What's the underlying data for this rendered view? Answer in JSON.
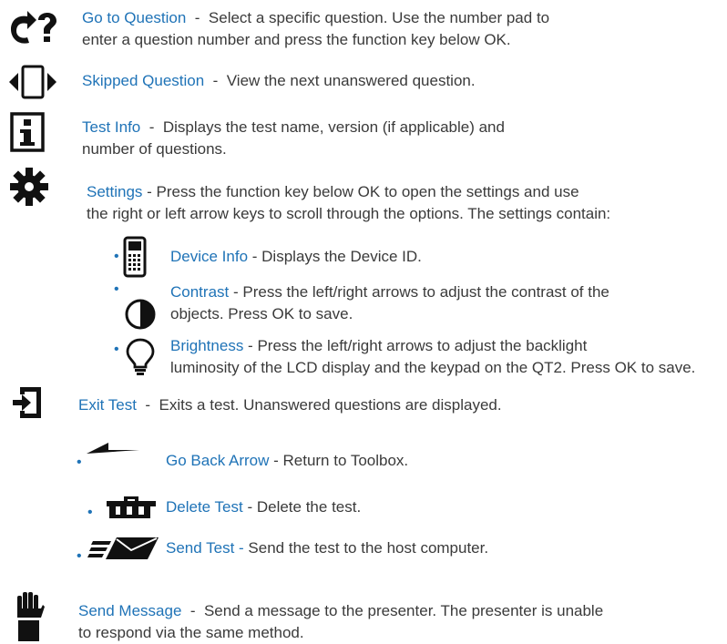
{
  "accent_color": "#1f73b7",
  "items": {
    "goto": {
      "icon": "go-to-question-icon",
      "term": "Go to Question",
      "sep": "  -  ",
      "line1": "Select a specific question. Use the number pad to",
      "line2": "enter a question number and press the function key below OK."
    },
    "skipped": {
      "icon": "skipped-question-icon",
      "term": "Skipped Question",
      "sep": "  -  ",
      "line1": "View the next unanswered question."
    },
    "testinfo": {
      "icon": "info-icon",
      "term": "Test Info",
      "sep": "  -  ",
      "line1": "Displays the test name, version (if applicable) and",
      "line2": "number of questions."
    },
    "settings": {
      "icon": "gear-icon",
      "term": "Settings",
      "sep": " - ",
      "line1": "Press the function key below OK to open the settings and use",
      "line2": "the right or left arrow keys to scroll through the options. The settings contain:"
    },
    "deviceinfo": {
      "icon": "device-icon",
      "term": "Device Info",
      "sep": " - ",
      "line1": "Displays the Device ID."
    },
    "contrast": {
      "icon": "contrast-icon",
      "term": "Contrast",
      "sep": " - ",
      "line1": "Press the left/right arrows to adjust the contrast of the",
      "line2": "objects. Press OK to save."
    },
    "brightness": {
      "icon": "lightbulb-icon",
      "term": "Brightness",
      "sep": " - ",
      "line1": "Press the left/right arrows to adjust the backlight",
      "line2": "luminosity of the LCD display and the keypad on the QT2.  Press OK to save."
    },
    "exittest": {
      "icon": "exit-icon",
      "term": "Exit Test",
      "sep": "  -  ",
      "line1": "Exits a test. Unanswered questions are displayed."
    },
    "goback": {
      "icon": "back-arrow-icon",
      "term": "Go Back Arrow",
      "sep": " - ",
      "line1": "Return to Toolbox."
    },
    "deletetest": {
      "icon": "trash-icon",
      "term": "Delete Test",
      "sep": " - ",
      "line1": "Delete the test."
    },
    "sendtest": {
      "icon": "send-icon",
      "term": "Send Test -",
      "sep": " ",
      "line1": "Send the test to the host computer."
    },
    "sendmessage": {
      "icon": "raised-hand-icon",
      "term": "Send Message",
      "sep": "  -  ",
      "line1": "Send a message to the presenter. The presenter is unable",
      "line2": "to respond via the same method."
    }
  },
  "bullet_char": "•"
}
